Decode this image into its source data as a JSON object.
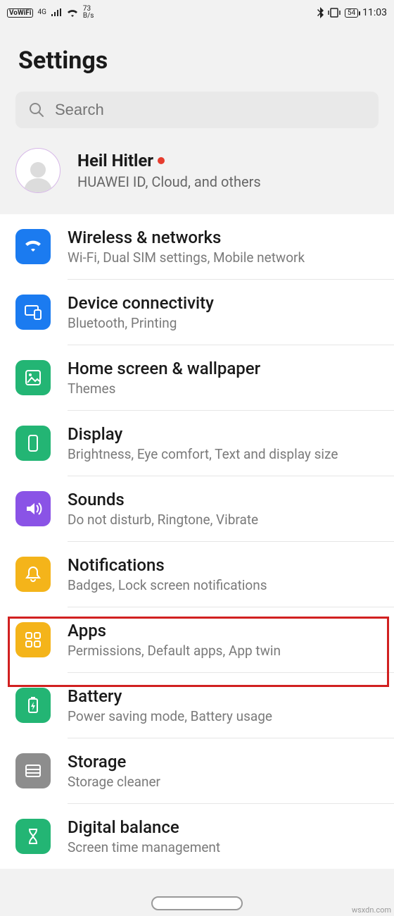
{
  "status": {
    "vowifi": "VoWiFi",
    "net": "4G",
    "speed_top": "73",
    "speed_bottom": "B/s",
    "battery": "54",
    "time": "11:03"
  },
  "title": "Settings",
  "search": {
    "placeholder": "Search"
  },
  "account": {
    "name": "Heil Hitler",
    "sub": "HUAWEI ID, Cloud, and others"
  },
  "rows": [
    {
      "icon": "wifi-icon",
      "color": "ic-blue",
      "title": "Wireless & networks",
      "sub": "Wi-Fi, Dual SIM settings, Mobile network"
    },
    {
      "icon": "devices-icon",
      "color": "ic-blue2",
      "title": "Device connectivity",
      "sub": "Bluetooth, Printing"
    },
    {
      "icon": "wallpaper-icon",
      "color": "ic-green",
      "title": "Home screen & wallpaper",
      "sub": "Themes"
    },
    {
      "icon": "display-icon",
      "color": "ic-green",
      "title": "Display",
      "sub": "Brightness, Eye comfort, Text and display size"
    },
    {
      "icon": "sound-icon",
      "color": "ic-purple",
      "title": "Sounds",
      "sub": "Do not disturb, Ringtone, Vibrate"
    },
    {
      "icon": "bell-icon",
      "color": "ic-yellow",
      "title": "Notifications",
      "sub": "Badges, Lock screen notifications"
    },
    {
      "icon": "apps-icon",
      "color": "ic-yellow",
      "title": "Apps",
      "sub": "Permissions, Default apps, App twin"
    },
    {
      "icon": "battery-icon",
      "color": "ic-green",
      "title": "Battery",
      "sub": "Power saving mode, Battery usage"
    },
    {
      "icon": "storage-icon",
      "color": "ic-grey",
      "title": "Storage",
      "sub": "Storage cleaner"
    },
    {
      "icon": "hourglass-icon",
      "color": "ic-green",
      "title": "Digital balance",
      "sub": "Screen time management"
    }
  ],
  "watermark": "wsxdn.com"
}
